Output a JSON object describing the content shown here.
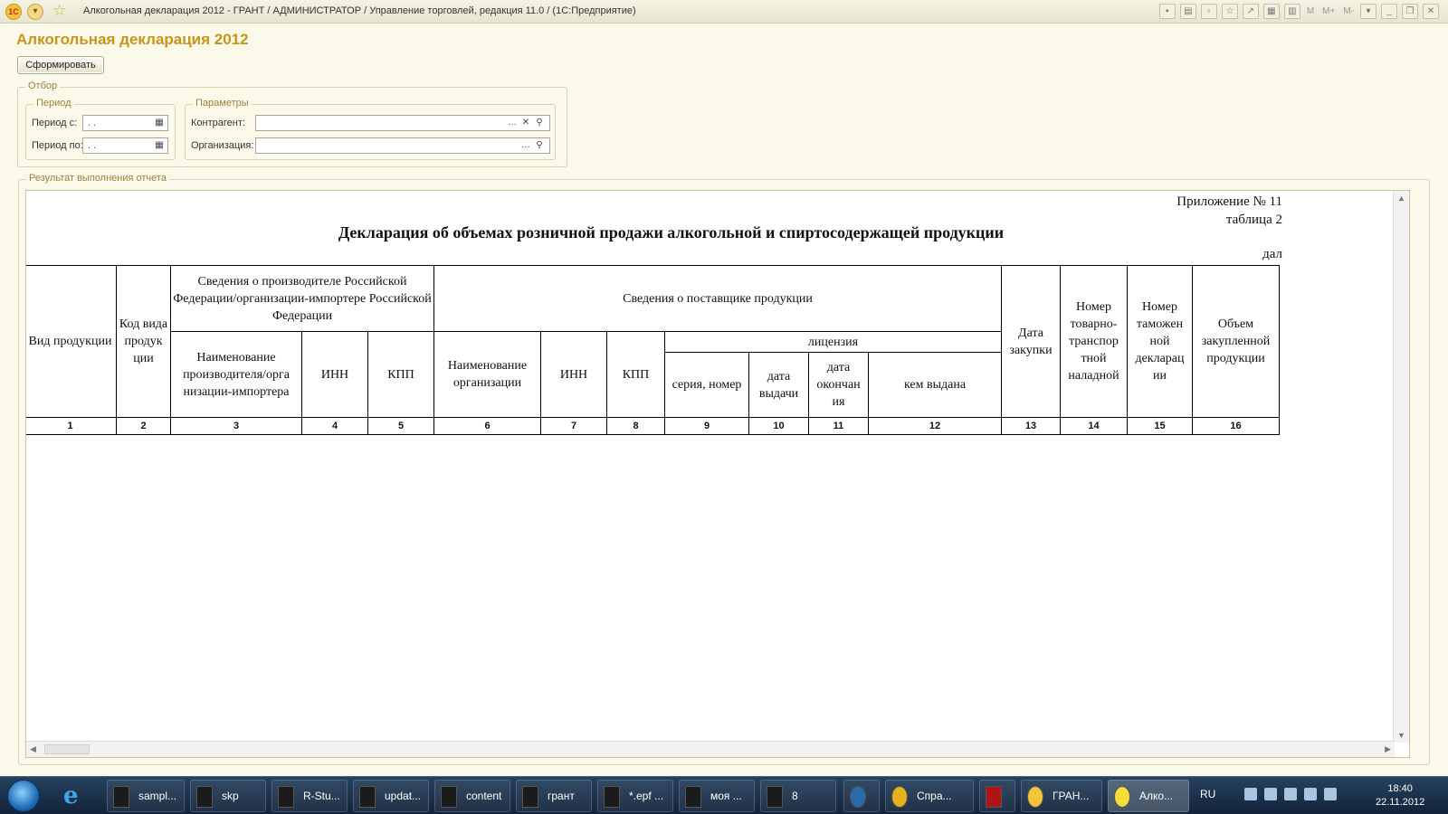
{
  "window": {
    "title": "Алкогольная декларация 2012 - ГРАНТ / АДМИНИСТРАТОР /  Управление торговлей, редакция 11.0 /  (1С:Предприятие)",
    "toolbar_texts": [
      "M",
      "M+",
      "M-"
    ]
  },
  "form": {
    "title": "Алкогольная декларация 2012",
    "generate_button": "Сформировать"
  },
  "filter": {
    "legend": "Отбор",
    "period": {
      "legend": "Период",
      "from_label": "Период с:",
      "from_value": " .  .",
      "to_label": "Период по:",
      "to_value": " .  ."
    },
    "params": {
      "legend": "Параметры",
      "counterparty_label": "Контрагент:",
      "counterparty_value": "",
      "organization_label": "Организация:",
      "organization_value": ""
    }
  },
  "result": {
    "legend": "Результат выполнения отчета",
    "appendix": "Приложение № 11",
    "table_no": "таблица 2",
    "doc_title": "Декларация об объемах розничной продажи  алкогольной  и спиртосодержащей продукции",
    "unit": "дал",
    "headers": {
      "c1": "Вид продукции",
      "c2": "Код вида продук ции",
      "producer_group": "Сведения о производителе Российской Федерации/организации-импортере Российской Федерации",
      "producer_name": "Наименование производителя/орга низации-импортера",
      "producer_inn": "ИНН",
      "producer_kpp": "КПП",
      "supplier_group": "Сведения о поставщике продукции",
      "supplier_name": "Наименование организации",
      "supplier_inn": "ИНН",
      "supplier_kpp": "КПП",
      "license_group": "лицензия",
      "license_series": "серия, номер",
      "license_issue": "дата выдачи",
      "license_end": "дата окончан ия",
      "license_by": "кем выдана",
      "purchase_date": "Дата закупки",
      "waybill_no": "Номер товарно-транспор тной наладной",
      "customs_no": "Номер таможен ной декларац ии",
      "volume": "Объем закупленной продукции"
    },
    "column_numbers": [
      "1",
      "2",
      "3",
      "4",
      "5",
      "6",
      "7",
      "8",
      "9",
      "10",
      "11",
      "12",
      "13",
      "14",
      "15",
      "16"
    ]
  },
  "taskbar": {
    "tasks": [
      "sampl...",
      "skp",
      "R-Stu...",
      "updat...",
      "content",
      "грант",
      "*.epf ...",
      "моя ...",
      "8",
      "",
      "Спра...",
      "",
      "ГРАН...",
      "Алко..."
    ],
    "lang": "RU",
    "time": "18:40",
    "date": "22.11.2012"
  }
}
